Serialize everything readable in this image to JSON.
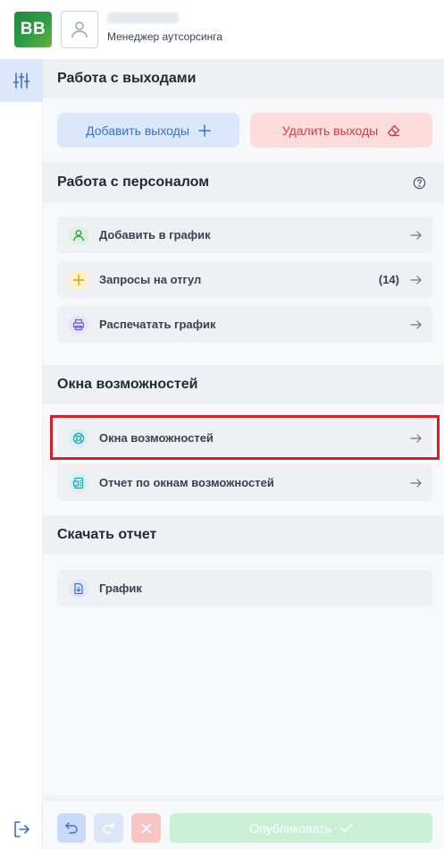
{
  "header": {
    "logo_text": "BB",
    "user_role": "Менеджер аутсорсинга"
  },
  "sections": {
    "shifts": {
      "title": "Работа с выходами",
      "add_label": "Добавить выходы",
      "delete_label": "Удалить выходы"
    },
    "staff": {
      "title": "Работа с персоналом",
      "items": [
        {
          "label": "Добавить в график",
          "icon": "person-icon"
        },
        {
          "label": "Запросы на отгул",
          "count": "(14)",
          "icon": "plus-icon"
        },
        {
          "label": "Распечатать график",
          "icon": "printer-icon"
        }
      ]
    },
    "opportunities": {
      "title": "Окна возможностей",
      "items": [
        {
          "label": "Окна возможностей",
          "icon": "lifebuoy-icon"
        },
        {
          "label": "Отчет по окнам возможностей",
          "icon": "report-icon"
        }
      ]
    },
    "download": {
      "title": "Скачать отчет",
      "items": [
        {
          "label": "График",
          "icon": "download-file-icon"
        }
      ]
    }
  },
  "footer": {
    "publish_label": "Опубликовать"
  },
  "colors": {
    "accent_blue": "#3b6fd1",
    "danger_red": "#d33c3c",
    "highlight_red": "#d81f26",
    "success_green": "#c9f0d4"
  }
}
